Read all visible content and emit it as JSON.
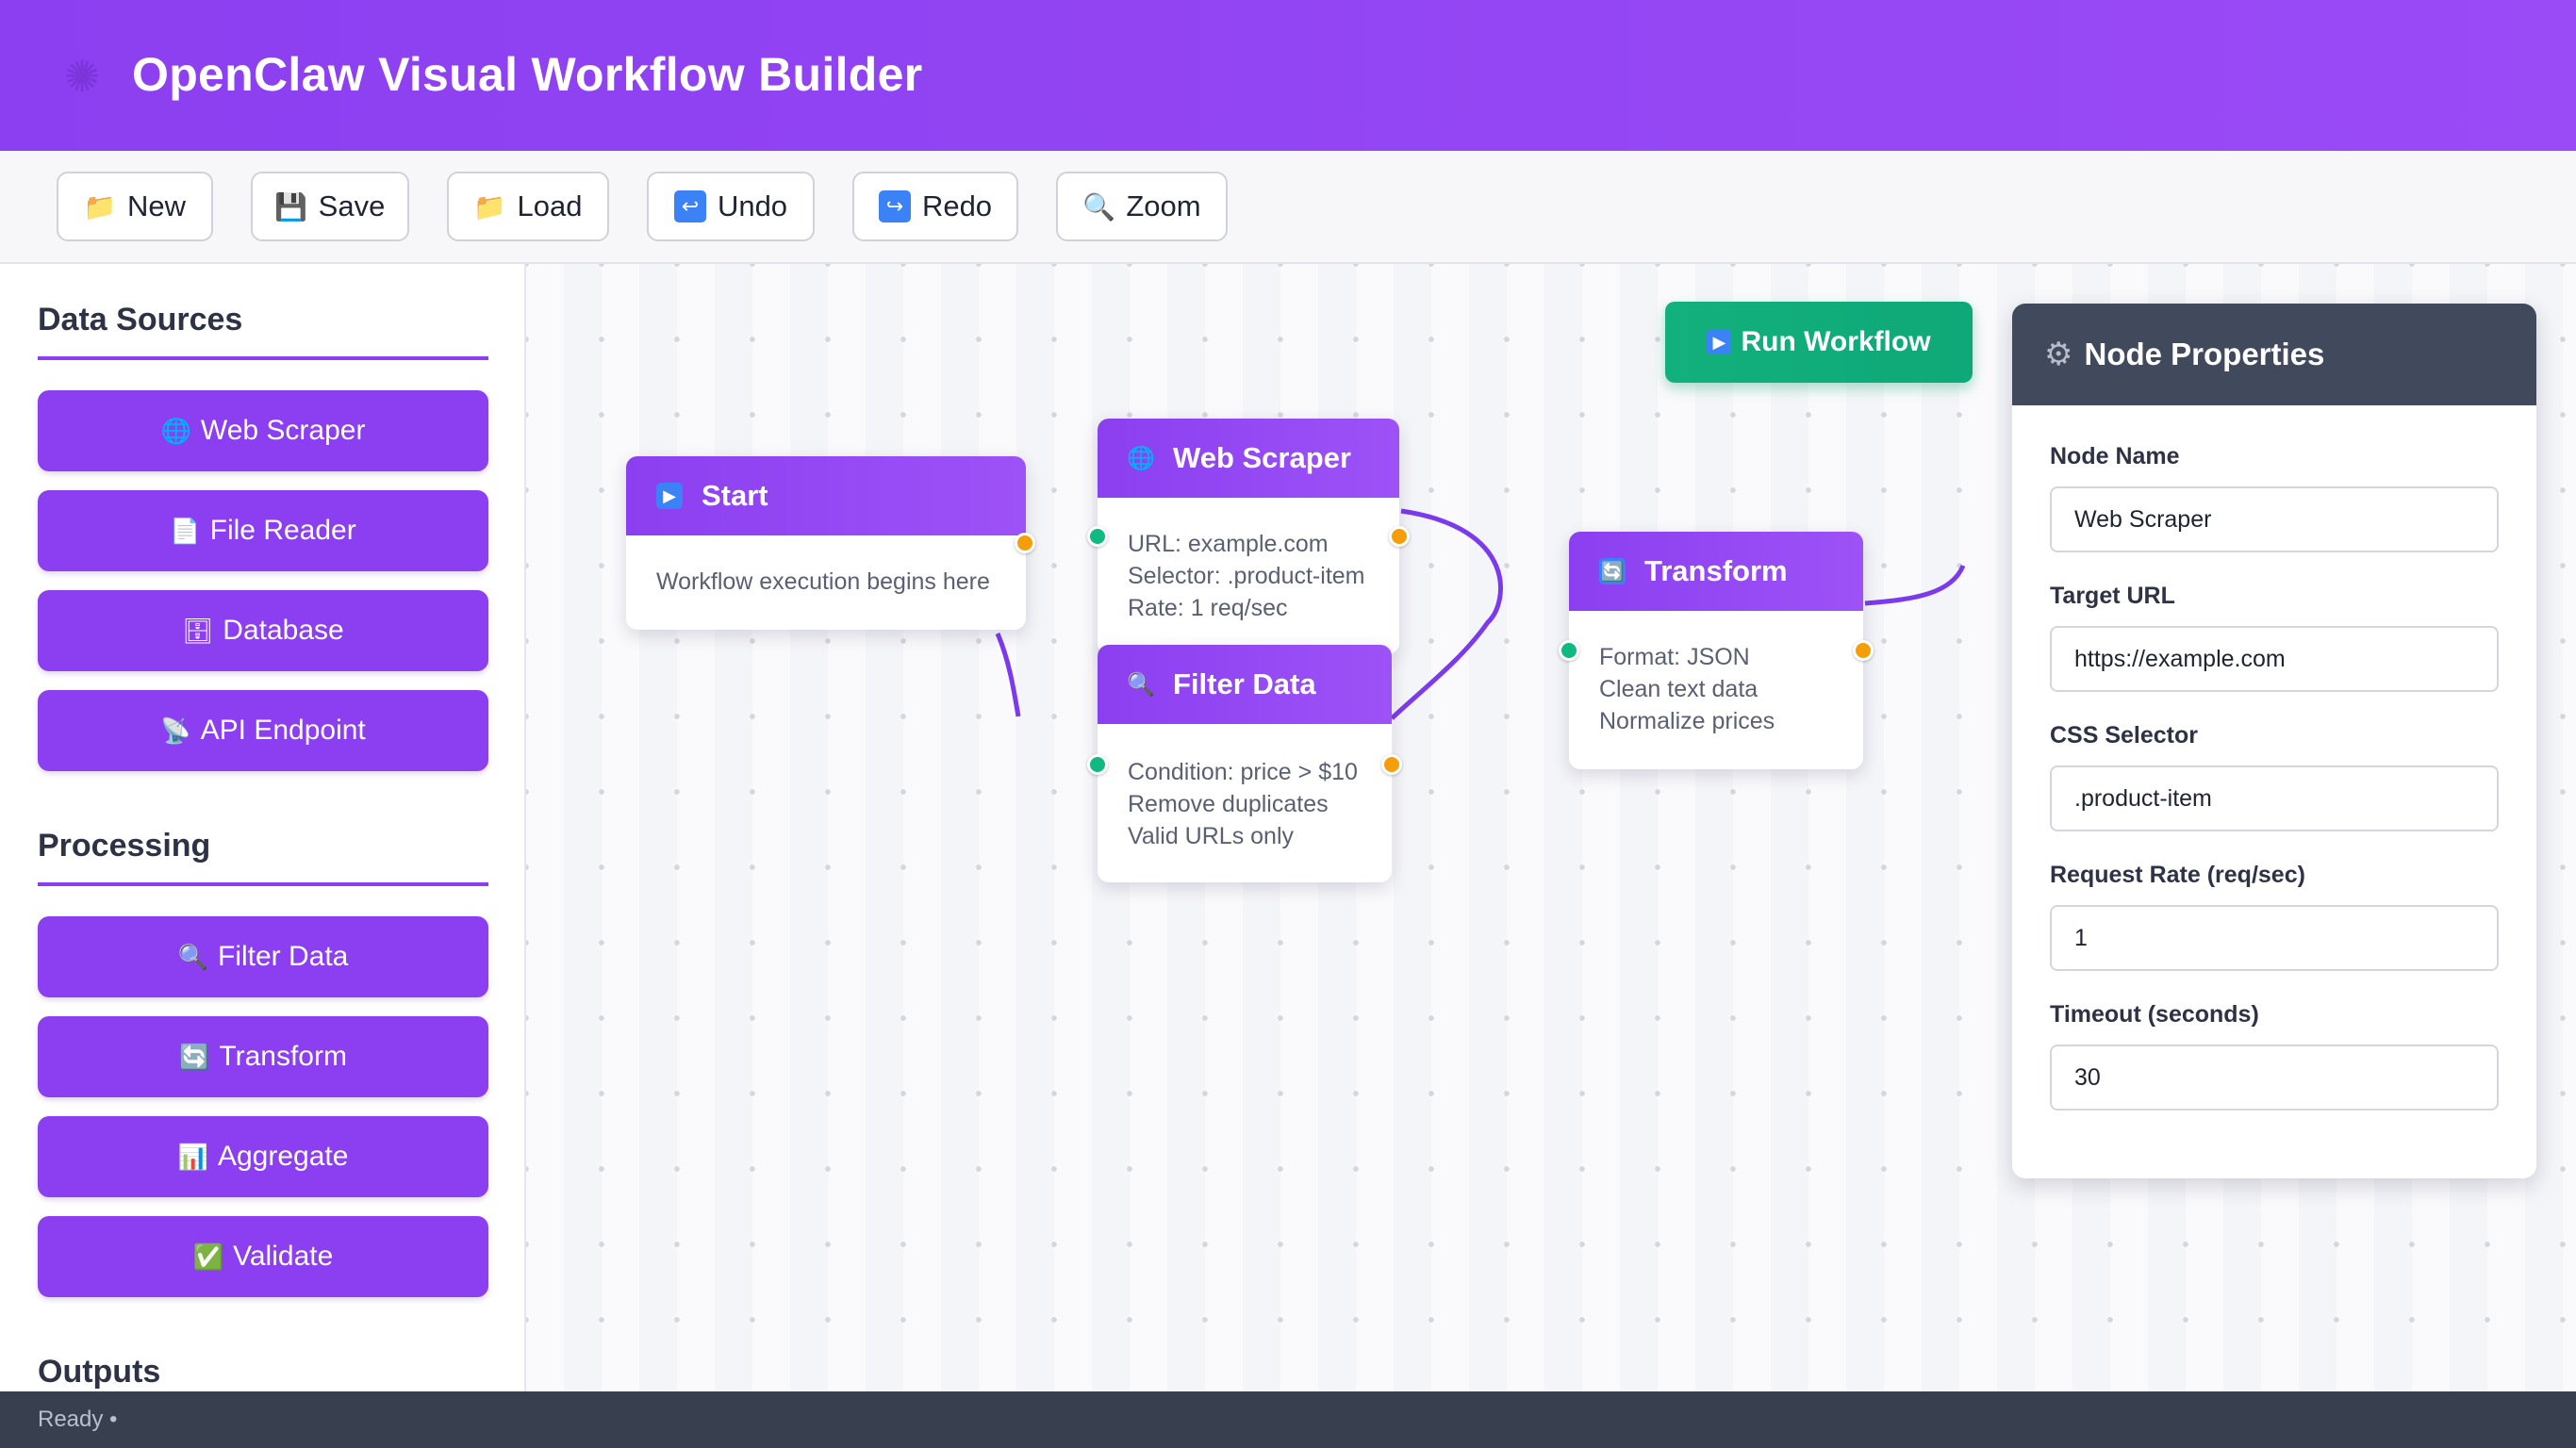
{
  "header": {
    "title": "OpenClaw Visual Workflow Builder",
    "logo_icon": "gear-icon"
  },
  "toolbar": {
    "buttons": [
      {
        "label": "New",
        "icon": "folder-icon",
        "glyph": "📁"
      },
      {
        "label": "Save",
        "icon": "floppy-icon",
        "glyph": "💾"
      },
      {
        "label": "Load",
        "icon": "folder-icon",
        "glyph": "📁"
      },
      {
        "label": "Undo",
        "icon": "undo-icon",
        "glyph": "↩"
      },
      {
        "label": "Redo",
        "icon": "redo-icon",
        "glyph": "↪"
      },
      {
        "label": "Zoom",
        "icon": "magnifier-icon",
        "glyph": "🔍"
      }
    ]
  },
  "sidebar": {
    "sections": [
      {
        "title": "Data Sources",
        "items": [
          {
            "label": "Web Scraper",
            "icon": "globe-icon",
            "glyph": "🌐"
          },
          {
            "label": "File Reader",
            "icon": "document-icon",
            "glyph": "📄"
          },
          {
            "label": "Database",
            "icon": "database-icon",
            "glyph": "🗄"
          },
          {
            "label": "API Endpoint",
            "icon": "satellite-icon",
            "glyph": "📡"
          }
        ]
      },
      {
        "title": "Processing",
        "items": [
          {
            "label": "Filter Data",
            "icon": "magnifier-icon",
            "glyph": "🔍"
          },
          {
            "label": "Transform",
            "icon": "refresh-icon",
            "glyph": "🔄"
          },
          {
            "label": "Aggregate",
            "icon": "bar-chart-icon",
            "glyph": "📊"
          },
          {
            "label": "Validate",
            "icon": "check-icon",
            "glyph": "✅"
          }
        ]
      },
      {
        "title": "Outputs",
        "items": []
      }
    ]
  },
  "canvas": {
    "run_button": {
      "label": "Run Workflow",
      "icon": "play-icon",
      "glyph": "▶"
    },
    "nodes": [
      {
        "id": "start",
        "title": "Start",
        "icon": "play-icon",
        "glyph": "▶",
        "lines": [
          "Workflow execution begins here"
        ]
      },
      {
        "id": "web-scraper",
        "title": "Web Scraper",
        "icon": "globe-icon",
        "glyph": "🌐",
        "lines": [
          "URL: example.com",
          "Selector: .product-item",
          "Rate: 1 req/sec"
        ]
      },
      {
        "id": "filter-data",
        "title": "Filter Data",
        "icon": "magnifier-icon",
        "glyph": "🔍",
        "lines": [
          "Condition: price > $10",
          "Remove duplicates",
          "Valid URLs only"
        ]
      },
      {
        "id": "transform",
        "title": "Transform",
        "icon": "refresh-icon",
        "glyph": "🔄",
        "lines": [
          "Format: JSON",
          "Clean text data",
          "Normalize prices"
        ]
      }
    ]
  },
  "properties": {
    "title": "Node Properties",
    "icon": "gear-icon",
    "fields": [
      {
        "label": "Node Name",
        "value": "Web Scraper"
      },
      {
        "label": "Target URL",
        "value": "https://example.com"
      },
      {
        "label": "CSS Selector",
        "value": ".product-item"
      },
      {
        "label": "Request Rate (req/sec)",
        "value": "1"
      },
      {
        "label": "Timeout (seconds)",
        "value": "30"
      }
    ]
  },
  "statusbar": {
    "text": "Ready •"
  },
  "colors": {
    "accent": "#8b3ff0",
    "run": "#12b07c",
    "port_in": "#10b981",
    "port_out": "#f59e0b",
    "panel_head": "#414a5c",
    "statusbar": "#383f4f"
  }
}
